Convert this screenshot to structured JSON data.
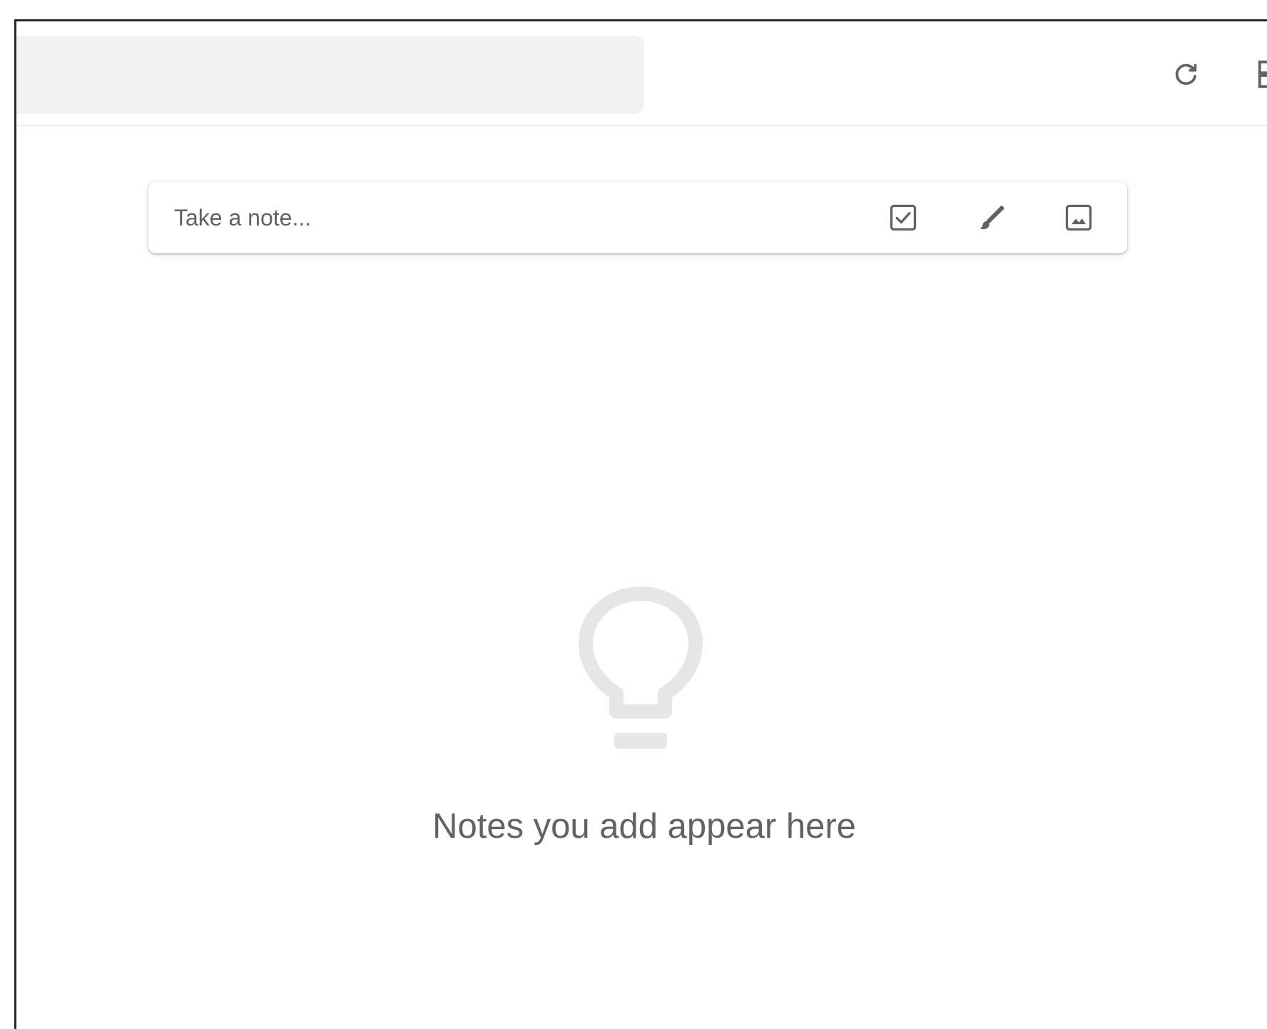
{
  "note_bar": {
    "placeholder": "Take a note..."
  },
  "toolbar_icons": {
    "refresh": "refresh-icon",
    "layout": "list-view-icon",
    "new_list": "checkbox-icon",
    "new_drawing": "brush-icon",
    "new_image": "image-icon"
  },
  "empty_state": {
    "message": "Notes you add appear here",
    "icon": "lightbulb-icon"
  },
  "colors": {
    "search_background": "#f3f2f2",
    "icon_gray": "#5f6368",
    "bulb_gray": "#e6e6e6"
  }
}
